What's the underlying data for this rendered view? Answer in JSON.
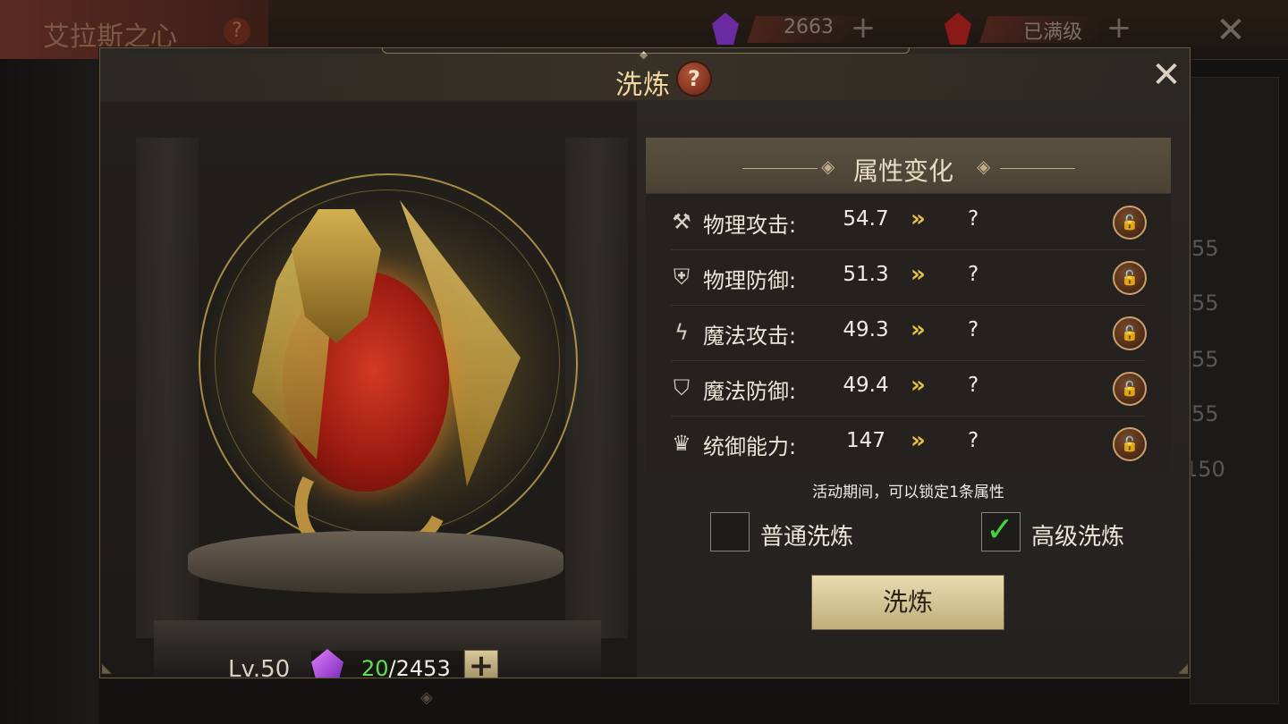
{
  "background": {
    "title": "艾拉斯之心",
    "help_glyph": "?",
    "resource_1_value": "2663",
    "resource_2_value": "已满级",
    "plus_glyph": "+",
    "close_glyph": "✕",
    "side_values": [
      "55",
      "55",
      "55",
      "55",
      "150"
    ]
  },
  "modal": {
    "title": "洗炼",
    "help_glyph": "?",
    "close_glyph": "✕"
  },
  "item": {
    "level_text": "Lv.50",
    "material_current": "20",
    "material_total": "/2453",
    "plus_glyph": "+"
  },
  "panel": {
    "title": "属性变化",
    "arrow_glyph": "»",
    "lock_glyph": "🔓",
    "rows": [
      {
        "icon": "axe-icon",
        "icon_glyph": "⚒",
        "label": "物理攻击:",
        "value": "54.7",
        "result": "?"
      },
      {
        "icon": "shield-icon",
        "icon_glyph": "⛨",
        "label": "物理防御:",
        "value": "51.3",
        "result": "?"
      },
      {
        "icon": "lightning-icon",
        "icon_glyph": "ϟ",
        "label": "魔法攻击:",
        "value": "49.3",
        "result": "?"
      },
      {
        "icon": "magic-shield-icon",
        "icon_glyph": "⛉",
        "label": "魔法防御:",
        "value": "49.4",
        "result": "?"
      },
      {
        "icon": "crown-icon",
        "icon_glyph": "♛",
        "label": "统御能力:",
        "value": "147",
        "result": "?"
      }
    ]
  },
  "hint": "活动期间，可以锁定1条属性",
  "options": {
    "normal_label": "普通洗炼",
    "normal_checked": false,
    "advanced_label": "高级洗炼",
    "advanced_checked": true,
    "check_glyph": "✓"
  },
  "action_button": "洗炼",
  "colors": {
    "accent_gold": "#f0d7a0",
    "check_green": "#48d040",
    "material_green": "#60e050"
  }
}
